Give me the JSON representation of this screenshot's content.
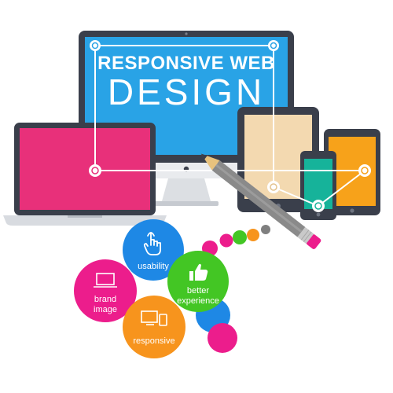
{
  "headline": {
    "line1": "RESPONSIVE WEB",
    "line2": "DESIGN"
  },
  "bubbles": [
    {
      "label_lines": [
        "usability"
      ],
      "icon": "hand-pointer-icon",
      "color": "#1e88e5"
    },
    {
      "label_lines": [
        "better",
        "experience"
      ],
      "icon": "thumbs-up-icon",
      "color": "#43c624"
    },
    {
      "label_lines": [
        "brand",
        "image"
      ],
      "icon": "laptop-icon",
      "color": "#ec1d8c"
    },
    {
      "label_lines": [
        "responsive"
      ],
      "icon": "devices-icon",
      "color": "#f7941d"
    }
  ],
  "colors": {
    "monitor_screen": "#29a3e6",
    "laptop_screen": "#e8307a",
    "tablet_screen": "#f3d9b0",
    "phone_screen": "#16b39a",
    "phone_large_screen": "#f7a21a",
    "device_frame": "#3a3f4b",
    "pencil_body": "#8a8a8a",
    "pencil_eraser": "#ec1d8c"
  }
}
